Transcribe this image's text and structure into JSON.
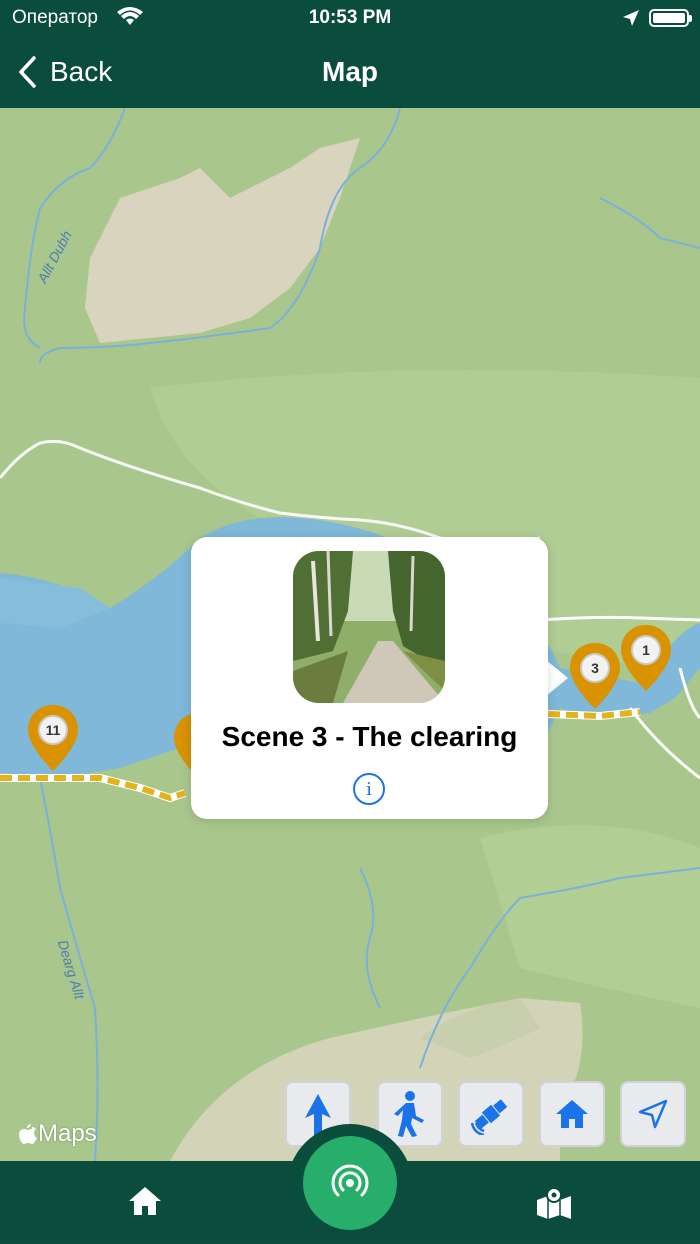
{
  "status_bar": {
    "carrier": "Оператор",
    "time": "10:53 PM"
  },
  "nav": {
    "back_label": "Back",
    "title": "Map"
  },
  "map": {
    "labels": [
      "Allt Dubh",
      "Dearg Allt"
    ],
    "pins": [
      "11",
      "3",
      "1"
    ],
    "attribution": "Maps"
  },
  "callout": {
    "title": "Scene 3 - The clearing",
    "info_icon": "info-icon"
  },
  "controls": [
    "north-arrow-icon",
    "walking-icon",
    "satellite-icon",
    "home-icon",
    "location-arrow-icon"
  ],
  "tabbar": {
    "left": "home-icon",
    "center": "broadcast-icon",
    "right": "map-icon"
  },
  "colors": {
    "header": "#0b4d3d",
    "fab": "#27ae6a",
    "pin": "#d99200",
    "route": "#e3b31e",
    "water": "#7fb8d9",
    "land": "#a9c78d"
  }
}
